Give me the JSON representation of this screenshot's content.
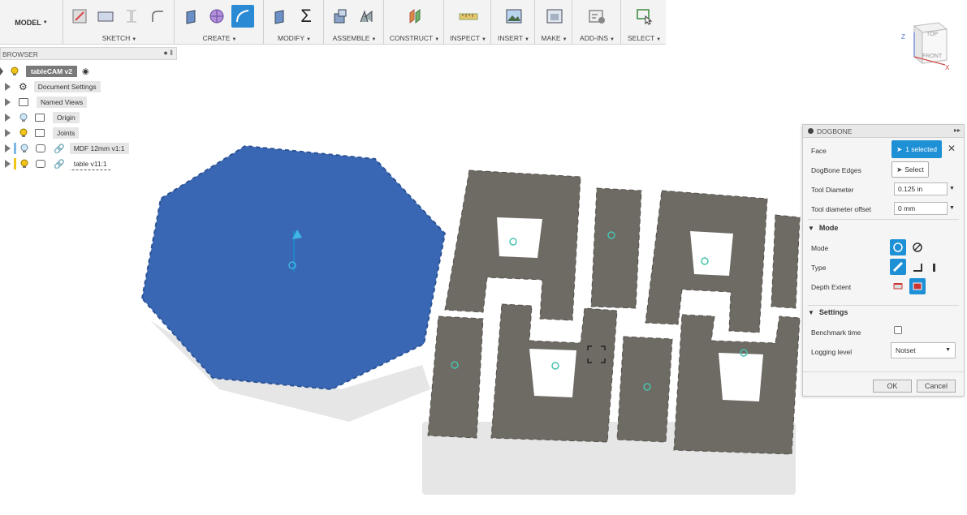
{
  "toolbar": {
    "model_label": "MODEL",
    "groups": [
      {
        "label": "SKETCH"
      },
      {
        "label": "CREATE"
      },
      {
        "label": "MODIFY"
      },
      {
        "label": "ASSEMBLE"
      },
      {
        "label": "CONSTRUCT"
      },
      {
        "label": "INSPECT"
      },
      {
        "label": "INSERT"
      },
      {
        "label": "MAKE"
      },
      {
        "label": "ADD-INS"
      },
      {
        "label": "SELECT"
      }
    ]
  },
  "browser": {
    "title": "BROWSER",
    "root": "tableCAM v2",
    "items": [
      {
        "label": "Document Settings",
        "icon": "gear-icon"
      },
      {
        "label": "Named Views",
        "icon": "folder-icon"
      },
      {
        "label": "Origin",
        "icon": "folder-icon"
      },
      {
        "label": "Joints",
        "icon": "folder-icon"
      },
      {
        "label": "MDF 12mm v1:1",
        "icon": "link-icon"
      },
      {
        "label": "table v11:1",
        "icon": "link-icon"
      }
    ]
  },
  "viewcube": {
    "top": "TOP",
    "front": "FRONT",
    "axis_z": "Z",
    "axis_x": "X"
  },
  "dogbone": {
    "title": "DOGBONE",
    "face_label": "Face",
    "face_value": "1 selected",
    "edges_label": "DogBone Edges",
    "edges_button": "Select",
    "tool_diameter_label": "Tool Diameter",
    "tool_diameter_value": "0.125 in",
    "tool_offset_label": "Tool diameter offset",
    "tool_offset_value": "0 mm",
    "mode_section": "Mode",
    "mode_label": "Mode",
    "type_label": "Type",
    "depth_label": "Depth Extent",
    "settings_section": "Settings",
    "benchmark_label": "Benchmark time",
    "logging_label": "Logging level",
    "logging_value": "Notset",
    "ok": "OK",
    "cancel": "Cancel"
  },
  "colors": {
    "accent": "#1e90d6",
    "face_blue": "#3a67b3",
    "panel_gray": "#6e6a64"
  }
}
